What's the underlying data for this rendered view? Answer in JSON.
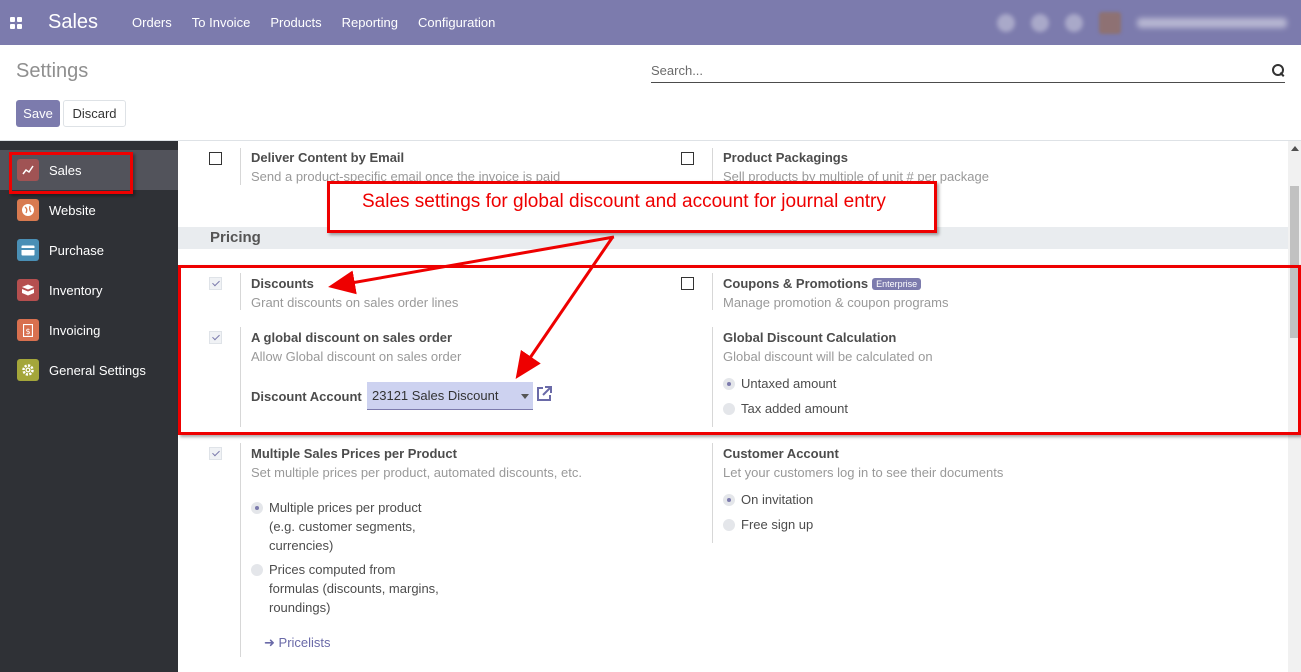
{
  "navbar": {
    "app_title": "Sales",
    "menu": [
      "Orders",
      "To Invoice",
      "Products",
      "Reporting",
      "Configuration"
    ]
  },
  "control": {
    "page_title": "Settings",
    "search_placeholder": "Search...",
    "save_label": "Save",
    "discard_label": "Discard"
  },
  "sidebar": {
    "items": [
      {
        "label": "Sales",
        "icon": "sales-chart-icon",
        "color": "#a05354"
      },
      {
        "label": "Website",
        "icon": "globe-icon",
        "color": "#d87a50"
      },
      {
        "label": "Purchase",
        "icon": "credit-card-icon",
        "color": "#4a8fb5"
      },
      {
        "label": "Inventory",
        "icon": "box-icon",
        "color": "#b54f4f"
      },
      {
        "label": "Invoicing",
        "icon": "invoice-icon",
        "color": "#d8704f"
      },
      {
        "label": "General Settings",
        "icon": "gear-icon",
        "color": "#a4a63a"
      }
    ]
  },
  "settings": {
    "deliver_email": {
      "title": "Deliver Content by Email",
      "desc": "Send a product-specific email once the invoice is paid"
    },
    "product_packagings": {
      "title": "Product Packagings",
      "desc": "Sell products by multiple of unit # per package"
    },
    "section_pricing": "Pricing",
    "discounts": {
      "title": "Discounts",
      "desc": "Grant discounts on sales order lines"
    },
    "coupons": {
      "title": "Coupons & Promotions",
      "badge": "Enterprise",
      "desc": "Manage promotion & coupon programs"
    },
    "global_discount": {
      "title": "A global discount on sales order",
      "desc": "Allow Global discount on sales order",
      "account_label": "Discount Account",
      "account_value": "23121 Sales Discount"
    },
    "global_calc": {
      "title": "Global Discount Calculation",
      "desc": "Global discount will be calculated on",
      "options": [
        "Untaxed amount",
        "Tax added amount"
      ],
      "selected": "Untaxed amount"
    },
    "multi_prices": {
      "title": "Multiple Sales Prices per Product",
      "desc": "Set multiple prices per product, automated discounts, etc.",
      "option1": [
        "Multiple prices per product",
        "(e.g. customer segments,",
        "currencies)"
      ],
      "option2": [
        "Prices computed from",
        "formulas (discounts, margins,",
        "roundings)"
      ],
      "link": "Pricelists"
    },
    "customer_account": {
      "title": "Customer Account",
      "desc": "Let your customers log in to see their documents",
      "options": [
        "On invitation",
        "Free sign up"
      ],
      "selected": "On invitation"
    }
  },
  "annotation": {
    "text": "Sales settings for global discount and account for journal entry",
    "color": "#ee0000"
  },
  "colors": {
    "brand": "#7c7bad",
    "sidebar_bg": "#2f3136"
  }
}
